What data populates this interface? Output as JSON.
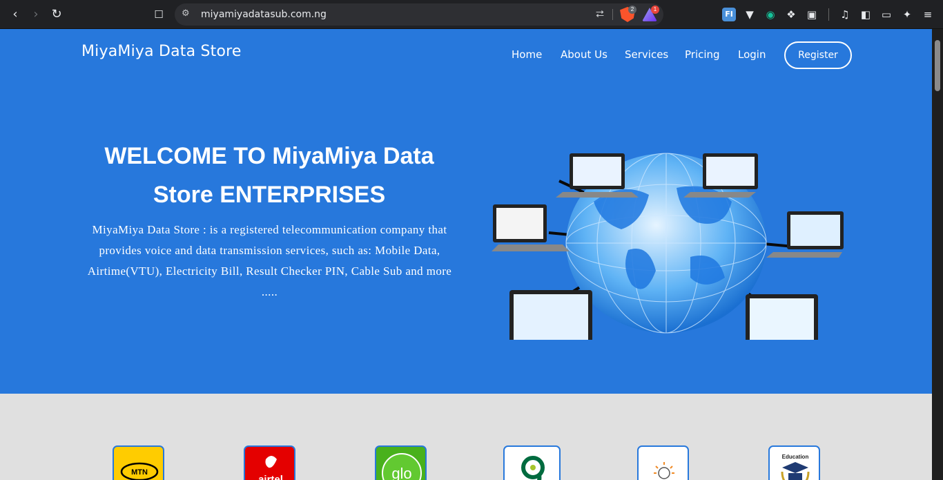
{
  "browser": {
    "url": "miyamiyadatasub.com.ng",
    "shield_count": "2",
    "rewards_count": "1",
    "ext_fi_label": "FI"
  },
  "site": {
    "brand": "MiyaMiya Data Store",
    "nav": [
      "Home",
      "About Us",
      "Services",
      "Pricing",
      "Login"
    ],
    "register_label": "Register",
    "headline": "WELCOME TO MiyaMiya Data Store ENTERPRISES",
    "description": "MiyaMiya Data Store : is a registered telecommunication company that provides voice and data transmission services, such as: Mobile Data, Airtime(VTU), Electricity Bill, Result Checker PIN, Cable Sub and more .....",
    "cards": [
      {
        "name": "MTN",
        "label": "MTN"
      },
      {
        "name": "airtel",
        "label": "airtel"
      },
      {
        "name": "glo",
        "label": "glo"
      },
      {
        "name": "9mobile",
        "label": ""
      },
      {
        "name": "electricity",
        "label": ""
      },
      {
        "name": "education",
        "label": "Education"
      }
    ]
  },
  "colors": {
    "hero": "#2778dc",
    "section_bg": "#e0e0e0",
    "mtn": "#ffcc00",
    "airtel": "#e40000",
    "glo": "#49b11c",
    "nine_mobile": "#006b3f"
  }
}
